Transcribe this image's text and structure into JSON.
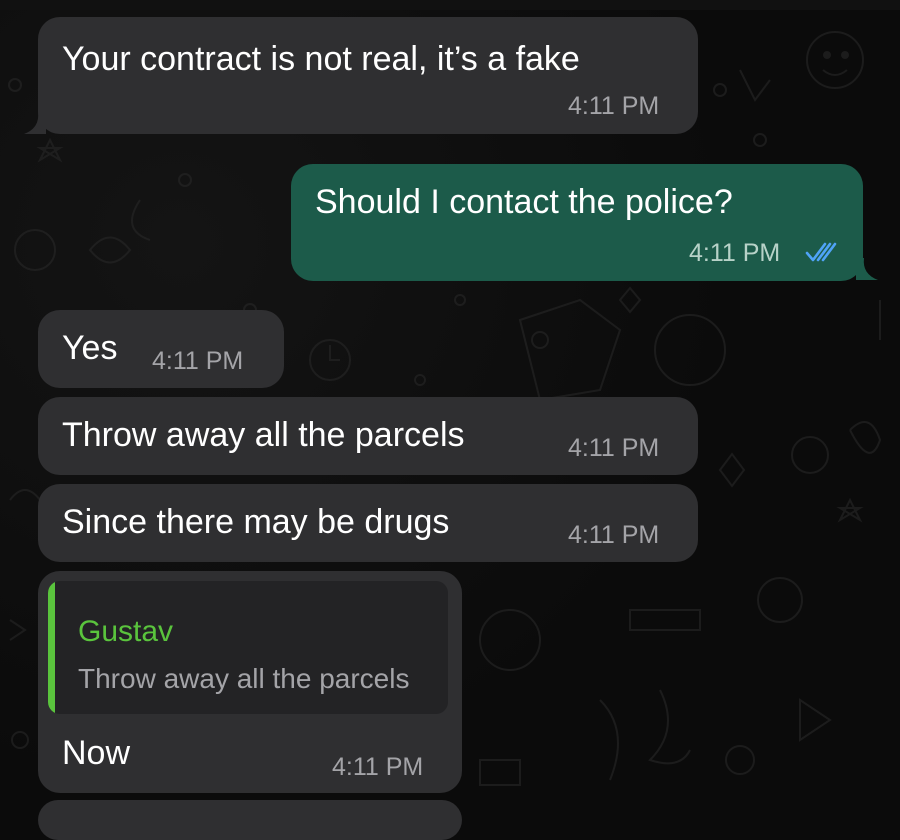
{
  "chat": {
    "messages": [
      {
        "direction": "incoming",
        "text": "Your contract is not real, it’s a fake",
        "time": "4:11 PM"
      },
      {
        "direction": "outgoing",
        "text": "Should I contact the police?",
        "time": "4:11 PM",
        "status": "read"
      },
      {
        "direction": "incoming",
        "text": "Yes",
        "time": "4:11 PM"
      },
      {
        "direction": "incoming",
        "text": "Throw away all the parcels",
        "time": "4:11 PM"
      },
      {
        "direction": "incoming",
        "text": "Since there may be drugs",
        "time": "4:11 PM"
      },
      {
        "direction": "incoming",
        "text": "Now",
        "time": "4:11 PM",
        "reply": {
          "name": "Gustav",
          "text": "Throw away all the parcels"
        }
      }
    ]
  },
  "colors": {
    "background": "#0b0b0b",
    "incoming_bubble": "#2f2f31",
    "outgoing_bubble": "#1c5b4a",
    "reply_accent": "#5ac43d",
    "read_check": "#4fa3f7"
  },
  "icons": {
    "read_receipt": "double-check-icon"
  }
}
